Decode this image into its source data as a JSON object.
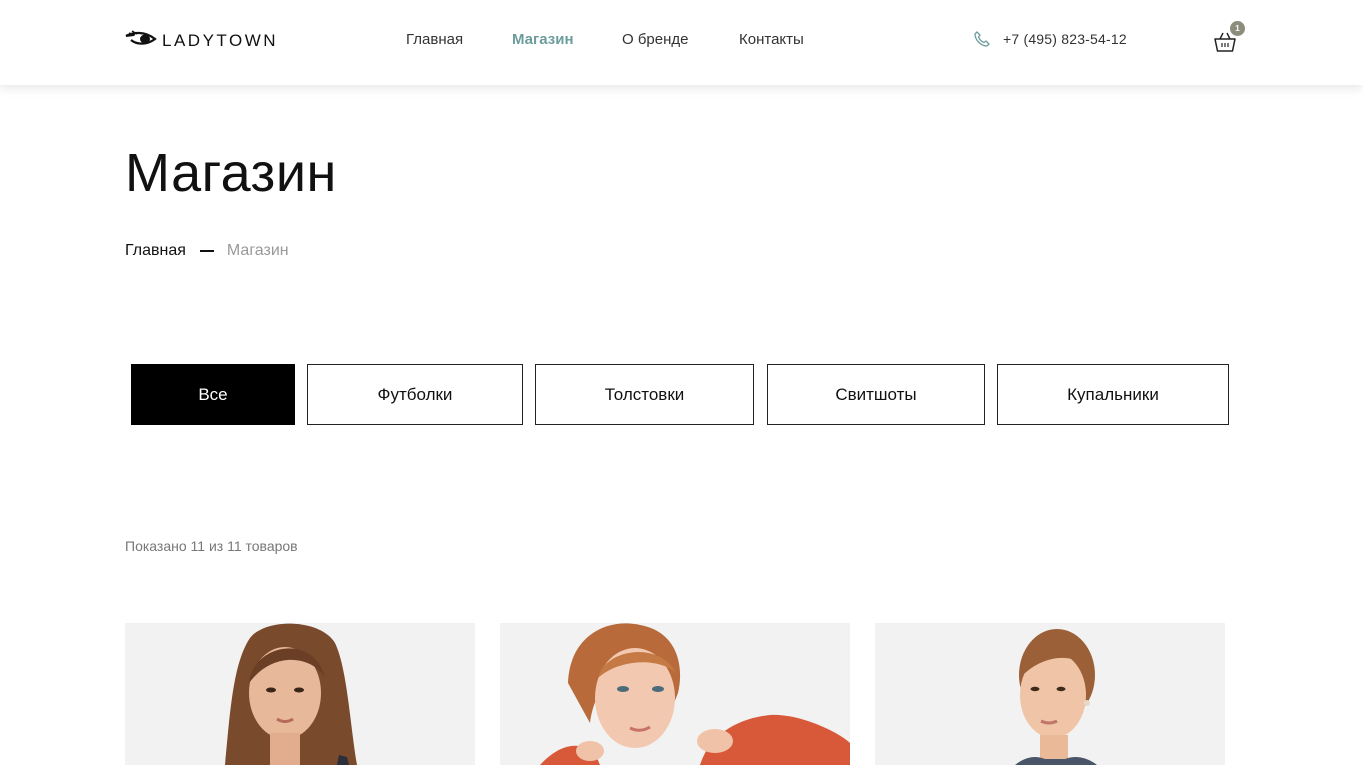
{
  "brand": {
    "name": "LADYTOWN",
    "icon": "eye-logo-icon"
  },
  "nav": {
    "items": [
      {
        "label": "Главная",
        "active": false
      },
      {
        "label": "Магазин",
        "active": true
      },
      {
        "label": "О бренде",
        "active": false
      },
      {
        "label": "Контакты",
        "active": false
      }
    ],
    "active_color": "#6d9c9c"
  },
  "contact": {
    "phone": "+7 (495) 823-54-12",
    "icon": "phone-icon"
  },
  "cart": {
    "count": "1",
    "icon": "basket-icon",
    "badge_color": "#8d8d7e"
  },
  "page": {
    "title": "Магазин"
  },
  "breadcrumb": {
    "home": "Главная",
    "current": "Магазин"
  },
  "filters": [
    {
      "label": "Все",
      "active": true
    },
    {
      "label": "Футболки",
      "active": false
    },
    {
      "label": "Толстовки",
      "active": false
    },
    {
      "label": "Свитшоты",
      "active": false
    },
    {
      "label": "Купальники",
      "active": false
    }
  ],
  "results": {
    "text": "Показано 11 из 11 товаров"
  },
  "products": [
    {
      "image": "product-photo-1"
    },
    {
      "image": "product-photo-2"
    },
    {
      "image": "product-photo-3"
    }
  ]
}
